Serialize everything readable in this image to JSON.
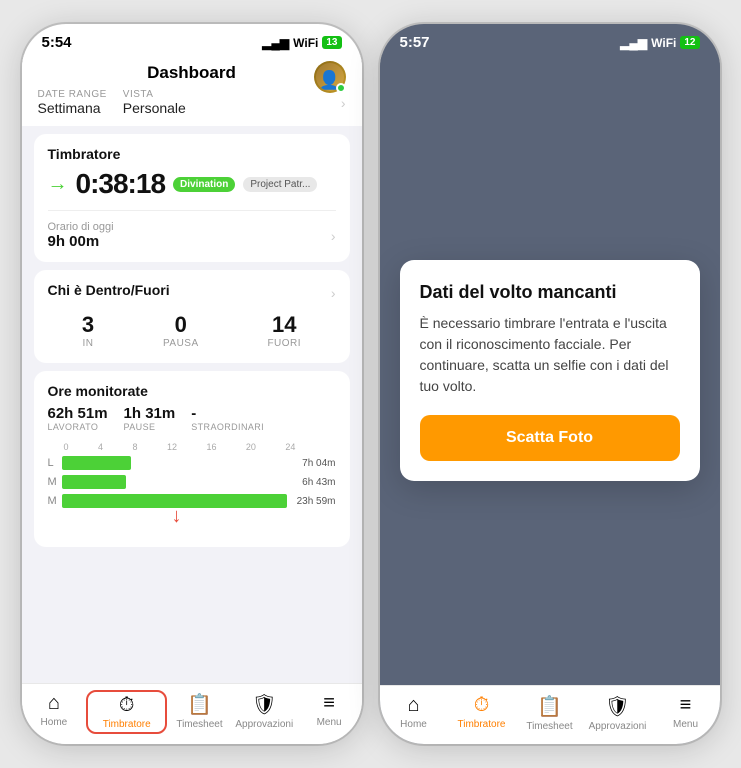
{
  "phone1": {
    "status_time": "5:54",
    "battery": "13",
    "header": {
      "title": "Dashboard",
      "date_label": "DATE RANGE",
      "date_value": "Settimana",
      "vista_label": "VISTA",
      "vista_value": "Personale"
    },
    "timbratore_card": {
      "title": "Timbratore",
      "time": "0:38:18",
      "tag_divination": "Divination",
      "tag_project": "Project Patr...",
      "orario_label": "Orario di oggi",
      "orario_value": "9h 00m"
    },
    "dentro_card": {
      "title": "Chi è Dentro/Fuori",
      "in_num": "3",
      "in_label": "IN",
      "pausa_num": "0",
      "pausa_label": "PAUSA",
      "fuori_num": "14",
      "fuori_label": "FUORI"
    },
    "ore_card": {
      "title": "Ore monitorate",
      "lavorato_num": "62h 51m",
      "lavorato_label": "LAVORATO",
      "pause_num": "1h 31m",
      "pause_label": "PAUSE",
      "straord_num": "-",
      "straord_label": "STRAORDINARI",
      "chart_x_labels": [
        "0",
        "4",
        "8",
        "12",
        "16",
        "20",
        "24"
      ],
      "chart_rows": [
        {
          "label": "L",
          "pct": 30,
          "value": "7h 04m"
        },
        {
          "label": "M",
          "pct": 28,
          "value": "6h 43m"
        },
        {
          "label": "M",
          "pct": 98,
          "value": "23h 59m"
        }
      ]
    },
    "nav": {
      "items": [
        {
          "icon": "⌂",
          "label": "Home",
          "active": false
        },
        {
          "icon": "⏱",
          "label": "Timbratore",
          "active": true,
          "border": true
        },
        {
          "icon": "📋",
          "label": "Timesheet",
          "active": false
        },
        {
          "icon": "✓",
          "label": "Approvazioni",
          "active": false
        },
        {
          "icon": "≡",
          "label": "Menu",
          "active": false
        }
      ]
    }
  },
  "phone2": {
    "status_time": "5:57",
    "battery": "12",
    "modal": {
      "title": "Dati del volto mancanti",
      "body": "È necessario timbrare l'entrata e l'uscita con il riconoscimento facciale. Per continuare, scatta un selfie con i dati del tuo volto.",
      "button": "Scatta Foto"
    },
    "nav": {
      "items": [
        {
          "icon": "⌂",
          "label": "Home",
          "active": false
        },
        {
          "icon": "⏱",
          "label": "Timbratore",
          "active": true
        },
        {
          "icon": "📋",
          "label": "Timesheet",
          "active": false
        },
        {
          "icon": "✓",
          "label": "Approvazioni",
          "active": false
        },
        {
          "icon": "≡",
          "label": "Menu",
          "active": false
        }
      ]
    }
  }
}
